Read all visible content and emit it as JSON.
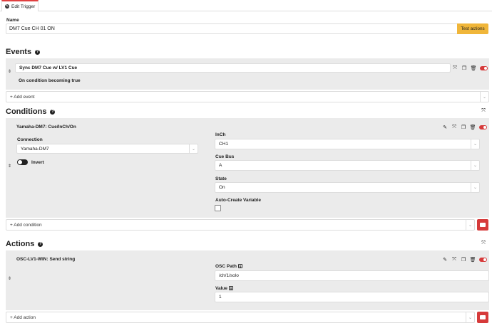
{
  "tab": {
    "label": "Edit Trigger",
    "icon": "edit-icon"
  },
  "name": {
    "label": "Name",
    "value": "DM7 Cue CH 01 ON",
    "test_button": "Test actions"
  },
  "events": {
    "title": "Events",
    "items": [
      {
        "value": "Sync DM7 Cue w/ LV1 Cue",
        "description": "On condition becoming true"
      }
    ],
    "add_placeholder": "+ Add event"
  },
  "conditions": {
    "title": "Conditions",
    "items": [
      {
        "title": "Yamaha-DM7: Cue/InCh/On",
        "connection_label": "Connection",
        "connection_value": "Yamaha-DM7",
        "invert_label": "Invert",
        "inch_label": "InCh",
        "inch_value": "CH1",
        "cuebus_label": "Cue Bus",
        "cuebus_value": "A",
        "state_label": "State",
        "state_value": "On",
        "autocreate_label": "Auto-Create Variable"
      }
    ],
    "add_placeholder": "+ Add condition"
  },
  "actions": {
    "title": "Actions",
    "items": [
      {
        "title": "OSC-LV1-WIN: Send string",
        "osc_path_label": "OSC Path",
        "osc_path_value": "/ch/1/solo",
        "value_label": "Value",
        "value_value": "1"
      }
    ],
    "add_placeholder": "+ Add action"
  },
  "help_symbol": "?",
  "dollar_symbol": "$",
  "colors": {
    "accent_red": "#d63a3a",
    "test_button": "#f0b63a"
  }
}
